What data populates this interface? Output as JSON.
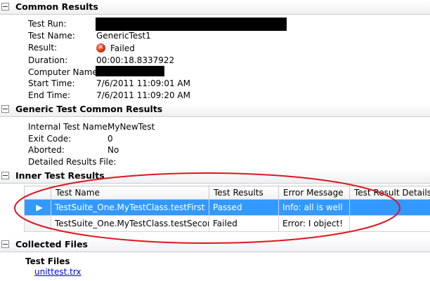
{
  "common": {
    "title": "Common Results",
    "labels": {
      "test_run": "Test Run:",
      "test_name": "Test Name:",
      "result": "Result:",
      "duration": "Duration:",
      "computer_name": "Computer Name:",
      "start_time": "Start Time:",
      "end_time": "End Time:"
    },
    "values": {
      "test_name": "GenericTest1",
      "result": "Failed",
      "duration": "00:00:18.8337922",
      "start_time": "7/6/2011 11:09:01 AM",
      "end_time": "7/6/2011 11:09:20 AM"
    }
  },
  "generic": {
    "title": "Generic Test Common Results",
    "labels": {
      "internal_test_name": "Internal Test Name:",
      "exit_code": "Exit Code:",
      "aborted": "Aborted:",
      "detailed_results_file": "Detailed Results File:"
    },
    "values": {
      "internal_test_name": "MyNewTest",
      "exit_code": "0",
      "aborted": "No"
    }
  },
  "inner": {
    "title": "Inner Test Results",
    "columns": [
      "Test Name",
      "Test Results",
      "Error Message",
      "Test Result Details"
    ],
    "rows": [
      {
        "name": "TestSuite_One.MyTestClass.testFirst",
        "result": "Passed",
        "error": "Info: all is well",
        "details": "",
        "selected": true
      },
      {
        "name": "TestSuite_One.MyTestClass.testSecond",
        "result": "Failed",
        "error": "Error: I object!",
        "details": "",
        "selected": false
      }
    ]
  },
  "files": {
    "title": "Collected Files",
    "subtitle": "Test Files",
    "link": "unittest.trx"
  },
  "colors": {
    "selection": "#3399ff",
    "annotation_ring": "#e0141c",
    "failed_icon": "#d2321a",
    "link": "#0000ee"
  }
}
